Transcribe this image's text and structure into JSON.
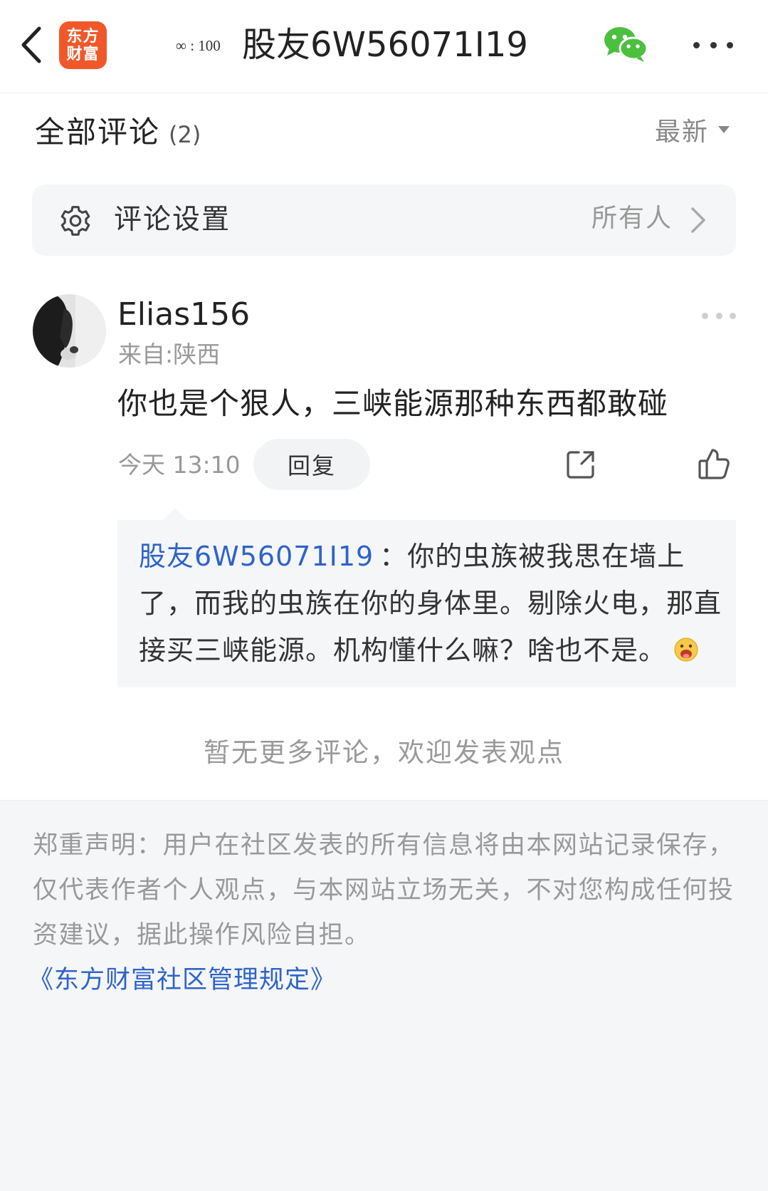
{
  "header": {
    "back_icon": "back-chevron-icon",
    "logo": {
      "line1": "东方",
      "line2": "财富"
    },
    "badge_text": "∞ : 100",
    "title": "股友6W56071I19",
    "share_icon": "wechat-icon",
    "more_icon": "more-dots-icon"
  },
  "comments_section": {
    "title": "全部评论",
    "count": "(2)",
    "sort_label": "最新",
    "sort_icon": "caret-down-icon"
  },
  "settings": {
    "icon": "gear-icon",
    "label": "评论设置",
    "value": "所有人",
    "chevron_icon": "chevron-right-icon"
  },
  "comment": {
    "author": "Elias156",
    "location": "来自:陕西",
    "content": "你也是个狠人，三峡能源那种东西都敢碰",
    "time": "今天 13:10",
    "reply_label": "回复",
    "more_icon": "more-dots-icon",
    "share_icon": "share-icon",
    "like_icon": "thumbs-up-icon",
    "reply": {
      "author": "股友6W56071I19",
      "content": "：你的虫族被我思在墙上了，而我的虫族在你的身体里。剔除火电，那直接买三峡能源。机构懂什么嘛？啥也不是。",
      "emoji_icon": "tongue-face-emoji-icon"
    }
  },
  "no_more": "暂无更多评论，欢迎发表观点",
  "footer": {
    "disclaimer": "郑重声明：用户在社区发表的所有信息将由本网站记录保存，仅代表作者个人观点，与本网站立场无关，不对您构成任何投资建议，据此操作风险自担。",
    "rules_link": "《东方财富社区管理规定》"
  },
  "colors": {
    "logo": "#f0582a",
    "link": "#2f64c8",
    "wechat": "#4cbf3f",
    "card_bg": "#f5f6f8",
    "muted_text": "#999999"
  }
}
